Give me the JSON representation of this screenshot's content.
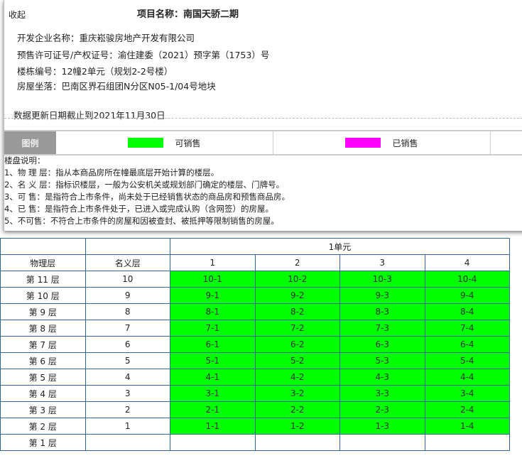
{
  "panel": {
    "collapse_label": "收起",
    "title": "项目名称：南国天骄二期",
    "developer": "开发企业名称：重庆崧骏房地产开发有限公司",
    "permit": "预售许可证号/产权证号：渝住建委（2021）预字第（1753）号",
    "building": "楼栋编号：12幢2单元（规划2-2号楼）",
    "location": "房屋坐落：巴南区界石组团N分区N05-1/04号地块",
    "update": "数据更新日期截止到2021年11月30日"
  },
  "legend": {
    "label": "图例",
    "items": [
      {
        "label": "可销售",
        "color": "#00ff00"
      },
      {
        "label": "已销售",
        "color": "#ff00ff"
      }
    ]
  },
  "notes": {
    "heading": "楼盘说明：",
    "items": [
      "1、物 理 层：指从本商品房所在幢最底层开始计算的楼层。",
      "2、名 义 层：指标识楼层，一般为公安机关或规划部门确定的楼层、门牌号。",
      "3、可 售：是指符合上市条件，尚未处于已经销售状态的商品房和预售商品房。",
      "4、已 售：是指符合上市条件处于，已进入或完成认购（含网签）的房屋。",
      "5、不可售：不符合上市条件的房屋和因被查封、被抵押等限制销售的房屋。"
    ]
  },
  "table": {
    "unit": "1单元",
    "col_physical": "物理层",
    "col_nominal": "名义层",
    "cols": [
      "1",
      "2",
      "3",
      "4"
    ],
    "available_color": "#00ff00",
    "rows": [
      {
        "floor": "第 11 层",
        "nominal": "10",
        "rooms": [
          "10-1",
          "10-2",
          "10-3",
          "10-4"
        ]
      },
      {
        "floor": "第 10 层",
        "nominal": "9",
        "rooms": [
          "9-1",
          "9-2",
          "9-3",
          "9-4"
        ]
      },
      {
        "floor": "第 9 层",
        "nominal": "8",
        "rooms": [
          "8-1",
          "8-2",
          "8-3",
          "8-4"
        ]
      },
      {
        "floor": "第 8 层",
        "nominal": "7",
        "rooms": [
          "7-1",
          "7-2",
          "7-3",
          "7-4"
        ]
      },
      {
        "floor": "第 7 层",
        "nominal": "6",
        "rooms": [
          "6-1",
          "6-2",
          "6-3",
          "6-4"
        ]
      },
      {
        "floor": "第 6 层",
        "nominal": "5",
        "rooms": [
          "5-1",
          "5-2",
          "5-3",
          "5-4"
        ]
      },
      {
        "floor": "第 5 层",
        "nominal": "4",
        "rooms": [
          "4-1",
          "4-2",
          "4-3",
          "4-4"
        ]
      },
      {
        "floor": "第 4 层",
        "nominal": "3",
        "rooms": [
          "3-1",
          "3-2",
          "3-3",
          "3-4"
        ]
      },
      {
        "floor": "第 3 层",
        "nominal": "2",
        "rooms": [
          "2-1",
          "2-2",
          "2-3",
          "2-4"
        ]
      },
      {
        "floor": "第 2 层",
        "nominal": "1",
        "rooms": [
          "1-1",
          "1-2",
          "1-3",
          "1-4"
        ]
      },
      {
        "floor": "第 1 层",
        "nominal": "",
        "rooms": [
          "",
          "",
          "",
          ""
        ]
      }
    ]
  }
}
